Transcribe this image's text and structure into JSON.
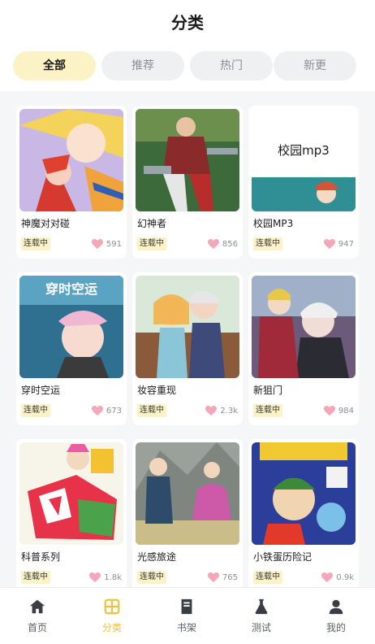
{
  "header": {
    "title": "分类"
  },
  "tabs": [
    {
      "label": "全部",
      "active": true
    },
    {
      "label": "推荐",
      "active": false
    },
    {
      "label": "热门",
      "active": false
    },
    {
      "label": "新更",
      "active": false
    }
  ],
  "comics": [
    {
      "title": "神魔对对碰",
      "status": "连载中",
      "likes": "591"
    },
    {
      "title": "幻神者",
      "status": "连载中",
      "likes": "856"
    },
    {
      "title": "校园MP3",
      "status": "连载中",
      "likes": "947",
      "cover_text": "校园mp3"
    },
    {
      "title": "穿时空运",
      "status": "连载中",
      "likes": "673",
      "cover_text": "穿时空运"
    },
    {
      "title": "妆容重现",
      "status": "连载中",
      "likes": "2.3k"
    },
    {
      "title": "新狙门",
      "status": "连载中",
      "likes": "984"
    },
    {
      "title": "科普系列",
      "status": "连载中",
      "likes": "1.8k"
    },
    {
      "title": "光感旅途",
      "status": "连载中",
      "likes": "765"
    },
    {
      "title": "小铁蛋历险记",
      "status": "连载中",
      "likes": "0.9k"
    }
  ],
  "tabbar": {
    "items": [
      {
        "label": "首页",
        "icon": "home-icon",
        "active": false
      },
      {
        "label": "分类",
        "icon": "category-grid-icon",
        "active": true
      },
      {
        "label": "书架",
        "icon": "book-icon",
        "active": false
      },
      {
        "label": "测试",
        "icon": "flask-icon",
        "active": false
      },
      {
        "label": "我的",
        "icon": "user-icon",
        "active": false
      }
    ]
  },
  "colors": {
    "accent": "#f0c23a",
    "badge_bg": "#fbf3c6",
    "heart": "#f4a7b9",
    "active_tab_bg": "#fbf3c6"
  }
}
